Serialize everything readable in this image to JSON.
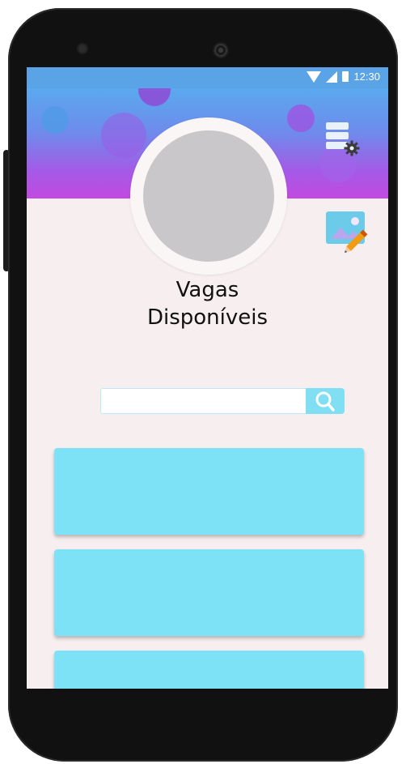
{
  "status_bar": {
    "time": "12:30",
    "icons": [
      "wifi-icon",
      "signal-icon",
      "battery-icon"
    ]
  },
  "header": {
    "gradient_colors": [
      "#5aa9ee",
      "#6e8bec",
      "#a45ae6",
      "#c24ae0"
    ],
    "menu_icon": "settings-menu-icon"
  },
  "profile": {
    "title_line1": "Vagas",
    "title_line2": "Disponíveis",
    "edit_icon": "edit-image-icon"
  },
  "search": {
    "value": "",
    "placeholder": "",
    "button_icon": "search-icon"
  },
  "job_list": {
    "cards": [
      {
        "id": 1
      },
      {
        "id": 2
      },
      {
        "id": 3
      }
    ],
    "card_color": "#7ee2f7"
  },
  "colors": {
    "background": "#f7efef",
    "accent": "#80dff3",
    "avatar": "#c9c7c9"
  }
}
